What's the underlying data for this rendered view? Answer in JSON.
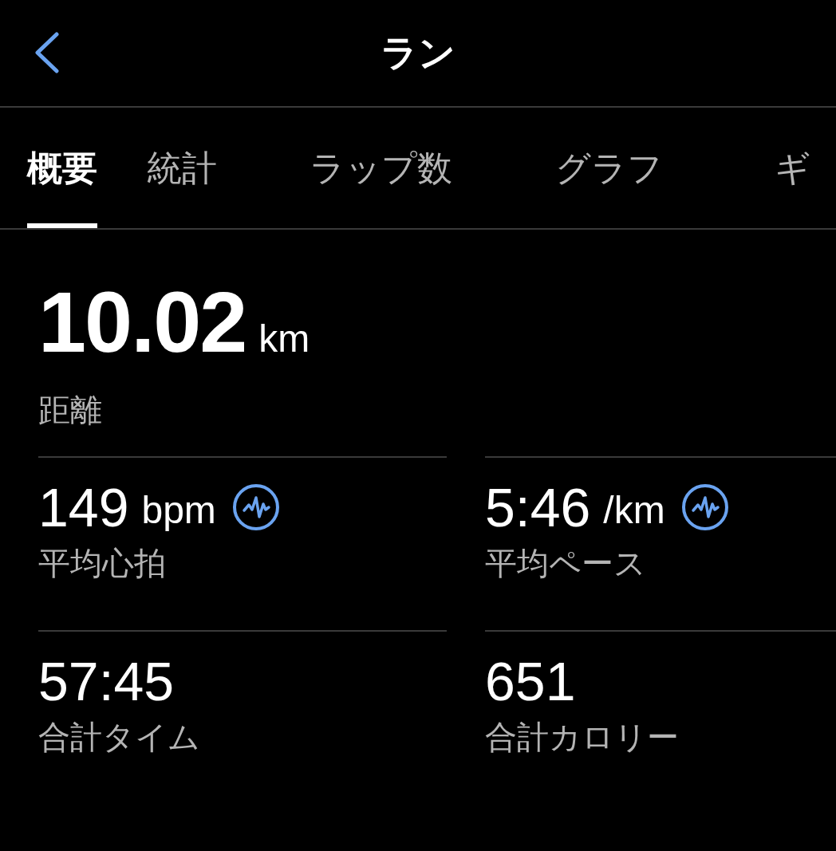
{
  "header": {
    "title": "ラン"
  },
  "tabs": [
    {
      "label": "概要",
      "selected": true
    },
    {
      "label": "統計",
      "selected": false
    },
    {
      "label": "ラップ数",
      "selected": false
    },
    {
      "label": "グラフ",
      "selected": false
    },
    {
      "label": "ギ",
      "selected": false
    }
  ],
  "distance": {
    "value": "10.02",
    "unit": "km",
    "label": "距離"
  },
  "stats": [
    {
      "value": "149",
      "unit": "bpm",
      "label": "平均心拍",
      "graph_icon": true
    },
    {
      "value": "5:46",
      "unit": "/km",
      "label": "平均ペース",
      "graph_icon": true
    },
    {
      "value": "57:45",
      "label": "合計タイム",
      "graph_icon": false
    },
    {
      "value": "651",
      "label": "合計カロリー",
      "graph_icon": false
    }
  ]
}
